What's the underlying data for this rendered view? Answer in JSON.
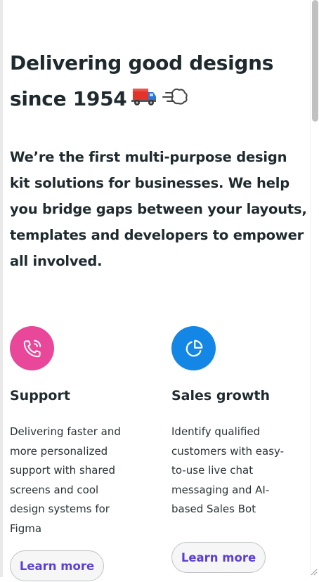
{
  "hero": {
    "headline": "Delivering good designs since 1954",
    "emoji_truck": "🚚",
    "emoji_dash": "💨",
    "intro": "We’re the first multi-purpose design kit solutions for businesses. We help you bridge gaps between your layouts, templates and developers to empower all involved."
  },
  "features": [
    {
      "icon": "phone-icon",
      "icon_bg": "#e8479a",
      "title": "Support",
      "description": "Delivering faster and more personalized support with shared screens and cool design systems for Figma",
      "button_label": "Learn more"
    },
    {
      "icon": "pie-chart-icon",
      "icon_bg": "#1487e6",
      "title": "Sales growth",
      "description": "Identify qualified customers with easy-to-use live chat messaging and AI-based Sales Bot",
      "button_label": "Learn more"
    }
  ],
  "colors": {
    "accent": "#5b3fd6",
    "text": "#1f2a2e",
    "button_border": "#bfc3c6"
  }
}
